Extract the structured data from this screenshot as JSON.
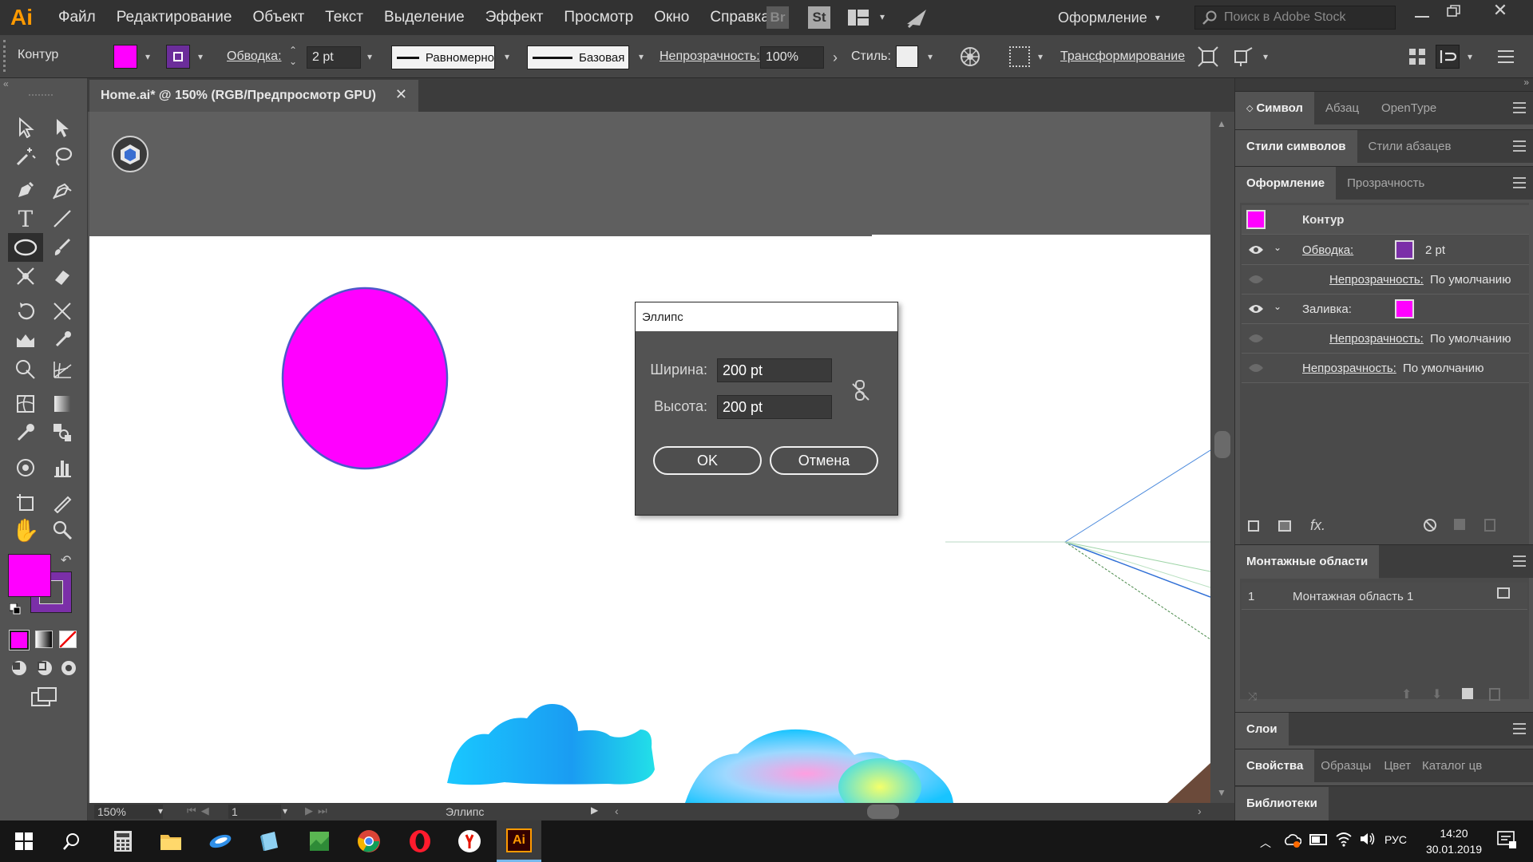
{
  "app": {
    "logo": "Ai",
    "workspace_label": "Оформление",
    "search_placeholder": "Поиск в Adobe Stock"
  },
  "menu": [
    "Файл",
    "Редактирование",
    "Объект",
    "Текст",
    "Выделение",
    "Эффект",
    "Просмотр",
    "Окно",
    "Справка"
  ],
  "menubar_icons": {
    "bridge": "Br",
    "stock": "St"
  },
  "control_bar": {
    "object_type": "Контур",
    "stroke_label": "Обводка:",
    "stroke_value": "2 pt",
    "profile_label": "Равномерно",
    "brush_label": "Базовая",
    "opacity_label": "Непрозрачность:",
    "opacity_value": "100%",
    "style_label": "Стиль:",
    "transform_label": "Трансформирование"
  },
  "document": {
    "tab_title": "Home.ai* @ 150% (RGB/Предпросмотр GPU)",
    "close": "✕"
  },
  "status_bar": {
    "zoom": "150%",
    "artboard_number": "1",
    "current_tool": "Эллипс"
  },
  "dialog": {
    "title": "Эллипс",
    "width_label": "Ширина:",
    "width_value": "200 pt",
    "height_label": "Высота:",
    "height_value": "200 pt",
    "ok_label": "OK",
    "cancel_label": "Отмена"
  },
  "panels": {
    "character_tabs": [
      "Символ",
      "Абзац",
      "OpenType"
    ],
    "styles_tabs": [
      "Стили символов",
      "Стили абзацев"
    ],
    "appearance_tabs": [
      "Оформление",
      "Прозрачность"
    ],
    "appearance": {
      "title": "Контур",
      "stroke_label": "Обводка:",
      "stroke_value": "2 pt",
      "stroke_opacity_label": "Непрозрачность:",
      "stroke_opacity_value": "По умолчанию",
      "fill_label": "Заливка:",
      "fill_opacity_label": "Непрозрачность:",
      "fill_opacity_value": "По умолчанию",
      "opacity_label": "Непрозрачность:",
      "opacity_value": "По умолчанию"
    },
    "artboards_title": "Монтажные области",
    "artboards": [
      {
        "number": "1",
        "name": "Монтажная область 1"
      }
    ],
    "layers_title": "Слои",
    "bottom_tabs": [
      "Свойства",
      "Образцы",
      "Цвет",
      "Каталог цв"
    ],
    "libraries_title": "Библиотеки"
  },
  "taskbar": {
    "language": "РУС",
    "time": "14:20",
    "date": "30.01.2019"
  },
  "colors": {
    "fill": "#ff00ff",
    "stroke": "#7b2fa8",
    "accent_ai": "#ff9a00"
  }
}
